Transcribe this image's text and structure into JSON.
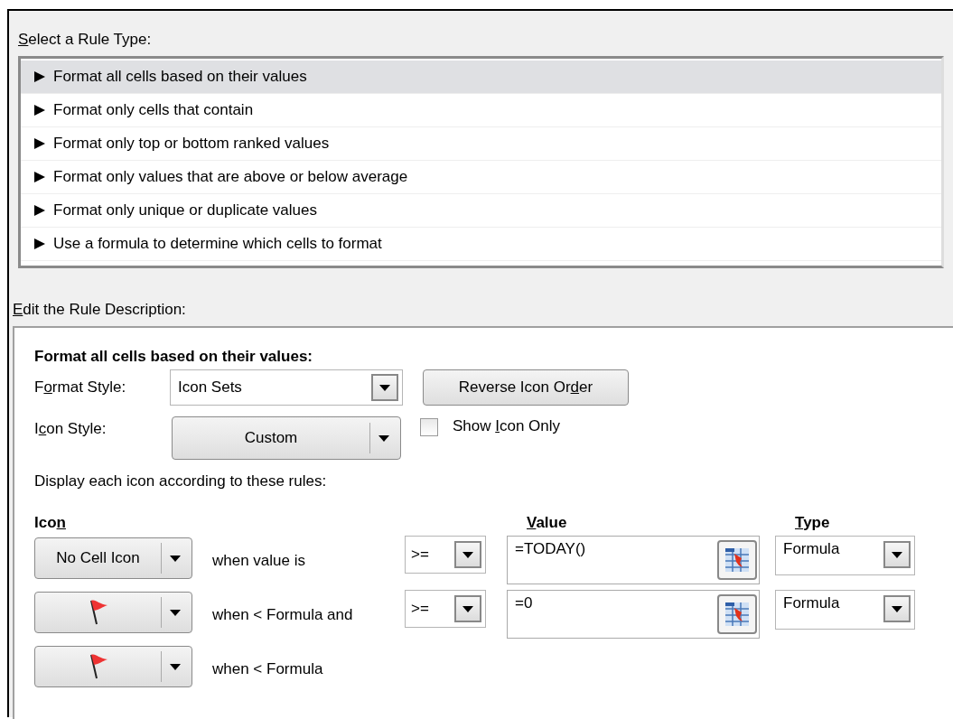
{
  "rule_type_label": {
    "key": "S",
    "after": "elect a Rule Type:"
  },
  "rule_types": [
    {
      "label": "Format all cells based on their values",
      "selected": true
    },
    {
      "label": "Format only cells that contain",
      "selected": false
    },
    {
      "label": "Format only top or bottom ranked values",
      "selected": false
    },
    {
      "label": "Format only values that are above or below average",
      "selected": false
    },
    {
      "label": "Format only unique or duplicate values",
      "selected": false
    },
    {
      "label": "Use a formula to determine which cells to format",
      "selected": false
    }
  ],
  "description_label": {
    "key": "E",
    "after": "dit the Rule Description:"
  },
  "description": {
    "heading": "Format all cells based on their values:",
    "format_style": {
      "label": {
        "before": "F",
        "key": "o",
        "after": "rmat Style:"
      },
      "value": "Icon Sets"
    },
    "reverse_button": {
      "before": "Reverse Icon Or",
      "key": "d",
      "after": "er"
    },
    "icon_style": {
      "label": {
        "before": "I",
        "key": "c",
        "after": "on Style:"
      },
      "value": "Custom"
    },
    "show_icon_only": {
      "label": {
        "before": "Show ",
        "key": "I",
        "after": "con Only"
      },
      "checked": false
    },
    "rules_caption": "Display each icon according to these rules:",
    "columns": [
      {
        "before": "Ico",
        "key": "n"
      },
      {
        "key": "V",
        "after": "alue"
      },
      {
        "key": "T",
        "after": "ype"
      }
    ],
    "rows": [
      {
        "icon": {
          "kind": "label",
          "text": "No Cell Icon"
        },
        "condition": "when value is",
        "operator": ">=",
        "value": "=TODAY()",
        "type": "Formula"
      },
      {
        "icon": {
          "kind": "flag"
        },
        "condition": "when < Formula and",
        "operator": ">=",
        "value": "=0",
        "type": "Formula"
      },
      {
        "icon": {
          "kind": "flag"
        },
        "condition": "when < Formula"
      }
    ]
  }
}
